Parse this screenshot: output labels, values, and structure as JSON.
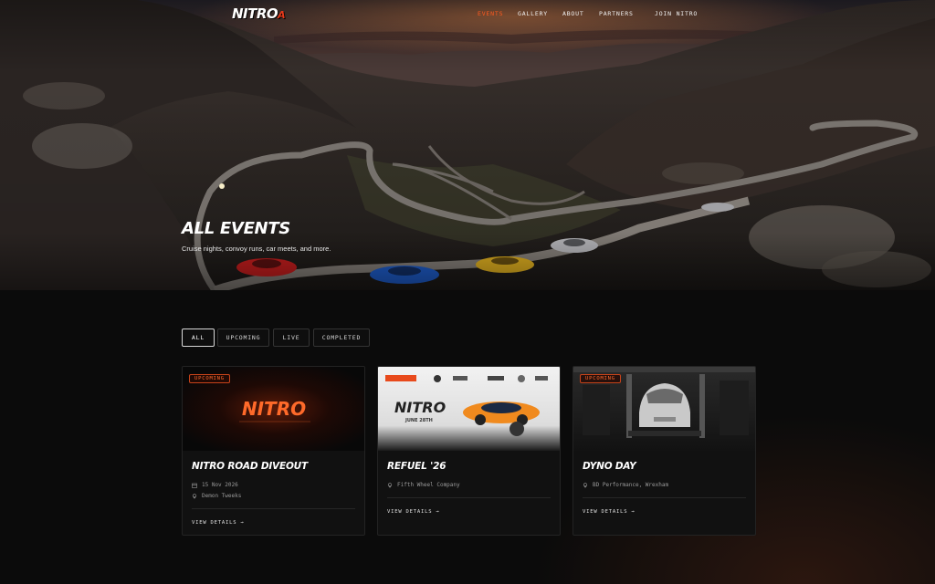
{
  "nav": {
    "logo": "NITRO",
    "logo_mark": "A",
    "links": [
      {
        "label": "EVENTS",
        "active": true
      },
      {
        "label": "GALLERY",
        "active": false
      },
      {
        "label": "ABOUT",
        "active": false
      },
      {
        "label": "PARTNERS",
        "active": false
      },
      {
        "label": "JOIN NITRO",
        "active": false
      }
    ]
  },
  "hero": {
    "title": "ALL EVENTS",
    "subtitle": "Cruise nights, convoy runs, car meets, and more."
  },
  "filters": [
    {
      "label": "ALL",
      "active": true
    },
    {
      "label": "UPCOMING",
      "active": false
    },
    {
      "label": "LIVE",
      "active": false
    },
    {
      "label": "COMPLETED",
      "active": false
    }
  ],
  "events": [
    {
      "badge": "UPCOMING",
      "title": "NITRO ROAD DIVEOUT",
      "date": "15 Nov 2026",
      "location": "Demon Tweeks",
      "cta": "VIEW DETAILS →",
      "image_logo_text": "NITRO"
    },
    {
      "badge": "",
      "title": "REFUEL '26",
      "location": "Fifth Wheel Company",
      "cta": "VIEW DETAILS →",
      "poster_text": "NITRO",
      "poster_subtext": "JUNE 28TH"
    },
    {
      "badge": "UPCOMING",
      "title": "DYNO DAY",
      "location": "BD Performance, Wrexham",
      "cta": "VIEW DETAILS →"
    }
  ],
  "colors": {
    "accent": "#ff5a1f",
    "background": "#0b0b0b",
    "card": "#111111",
    "border": "#232323"
  },
  "icons": [
    "calendar-icon",
    "location-pin-icon",
    "arrow-right-icon"
  ]
}
